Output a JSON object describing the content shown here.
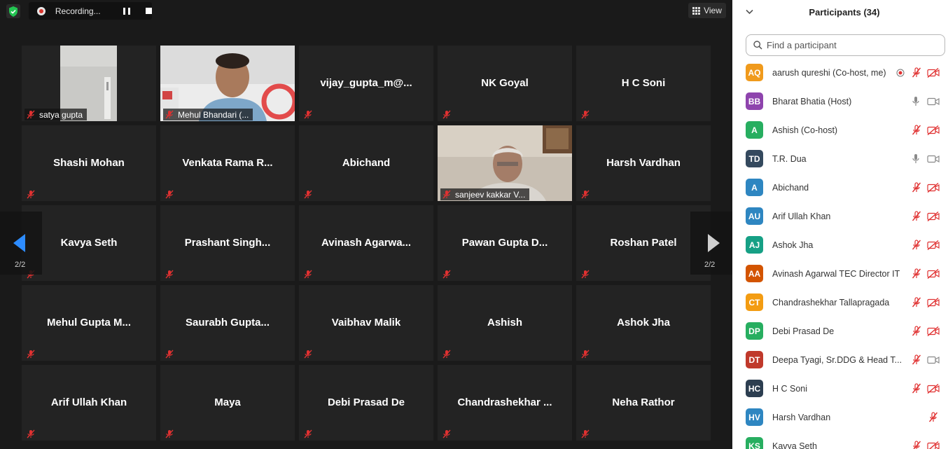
{
  "recording": {
    "label": "Recording..."
  },
  "view": {
    "label": "View"
  },
  "pager": {
    "left": "2/2",
    "right": "2/2"
  },
  "tiles": [
    {
      "name": "satya gupta",
      "video": true
    },
    {
      "name": "Mehul Bhandari (...",
      "video": true
    },
    {
      "name": "vijay_gupta_m@..."
    },
    {
      "name": "NK Goyal"
    },
    {
      "name": "H C Soni"
    },
    {
      "name": "Shashi Mohan"
    },
    {
      "name": "Venkata Rama R..."
    },
    {
      "name": "Abichand"
    },
    {
      "name": "sanjeev kakkar V...",
      "video": true
    },
    {
      "name": "Harsh Vardhan"
    },
    {
      "name": "Kavya Seth"
    },
    {
      "name": "Prashant Singh..."
    },
    {
      "name": "Avinash Agarwa..."
    },
    {
      "name": "Pawan Gupta D..."
    },
    {
      "name": "Roshan Patel"
    },
    {
      "name": "Mehul Gupta M..."
    },
    {
      "name": "Saurabh Gupta..."
    },
    {
      "name": "Vaibhav Malik"
    },
    {
      "name": "Ashish"
    },
    {
      "name": "Ashok Jha"
    },
    {
      "name": "Arif Ullah Khan"
    },
    {
      "name": "Maya"
    },
    {
      "name": "Debi Prasad De"
    },
    {
      "name": "Chandrashekhar ..."
    },
    {
      "name": "Neha Rathor"
    }
  ],
  "panel": {
    "title": "Participants (34)",
    "search_placeholder": "Find a participant",
    "participants": [
      {
        "initials": "AQ",
        "name": "aarush qureshi (Co-host, me)",
        "color": "#f09a1c",
        "mic": "muted",
        "cam": "off",
        "rec": true
      },
      {
        "initials": "BB",
        "name": "Bharat Bhatia (Host)",
        "color": "#8e44ad",
        "mic": "on",
        "cam": "on"
      },
      {
        "initials": "A",
        "name": "Ashish (Co-host)",
        "color": "#27ae60",
        "mic": "muted",
        "cam": "off"
      },
      {
        "initials": "TD",
        "name": "T.R. Dua",
        "color": "#34495e",
        "mic": "on",
        "cam": "on"
      },
      {
        "initials": "A",
        "name": "Abichand",
        "color": "#2e86c1",
        "mic": "muted",
        "cam": "off"
      },
      {
        "initials": "AU",
        "name": "Arif Ullah Khan",
        "color": "#2e86c1",
        "mic": "muted",
        "cam": "off"
      },
      {
        "initials": "AJ",
        "name": "Ashok Jha",
        "color": "#16a085",
        "mic": "muted",
        "cam": "off"
      },
      {
        "initials": "AA",
        "name": "Avinash Agarwal TEC Director IT",
        "color": "#d35400",
        "mic": "muted",
        "cam": "off"
      },
      {
        "initials": "CT",
        "name": "Chandrashekhar Tallapragada",
        "color": "#f39c12",
        "mic": "muted",
        "cam": "off"
      },
      {
        "initials": "DP",
        "name": "Debi Prasad De",
        "color": "#27ae60",
        "mic": "muted",
        "cam": "off"
      },
      {
        "initials": "DT",
        "name": "Deepa Tyagi, Sr.DDG & Head T...",
        "color": "#c0392b",
        "mic": "muted",
        "cam": "on"
      },
      {
        "initials": "HC",
        "name": "H C Soni",
        "color": "#2c3e50",
        "mic": "muted",
        "cam": "off"
      },
      {
        "initials": "HV",
        "name": "Harsh Vardhan",
        "color": "#2e86c1",
        "mic": "muted",
        "cam": "none"
      },
      {
        "initials": "KS",
        "name": "Kavya Seth",
        "color": "#27ae60",
        "mic": "muted",
        "cam": "off"
      }
    ]
  }
}
